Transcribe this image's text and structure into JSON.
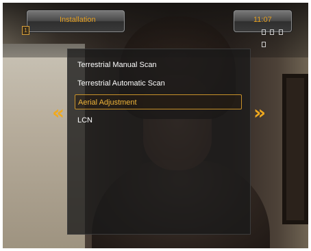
{
  "header": {
    "title": "Installation",
    "clock": "11:07"
  },
  "menu": {
    "items": [
      {
        "label": "Terrestrial Manual Scan",
        "selected": false
      },
      {
        "label": "Terrestrial Automatic Scan",
        "selected": false
      },
      {
        "label": "Aerial Adjustment",
        "selected": true
      },
      {
        "label": "LCN",
        "selected": false
      }
    ]
  },
  "navigation": {
    "left_arrow": "«",
    "right_arrow": "»"
  },
  "icons": {
    "left_indicator": "1",
    "status": [
      "signal-icon",
      "record-icon",
      "network-icon",
      "pip-icon"
    ]
  },
  "colors": {
    "accent": "#f0a91e",
    "highlight_border": "#c9922a",
    "text": "#ffffff"
  }
}
